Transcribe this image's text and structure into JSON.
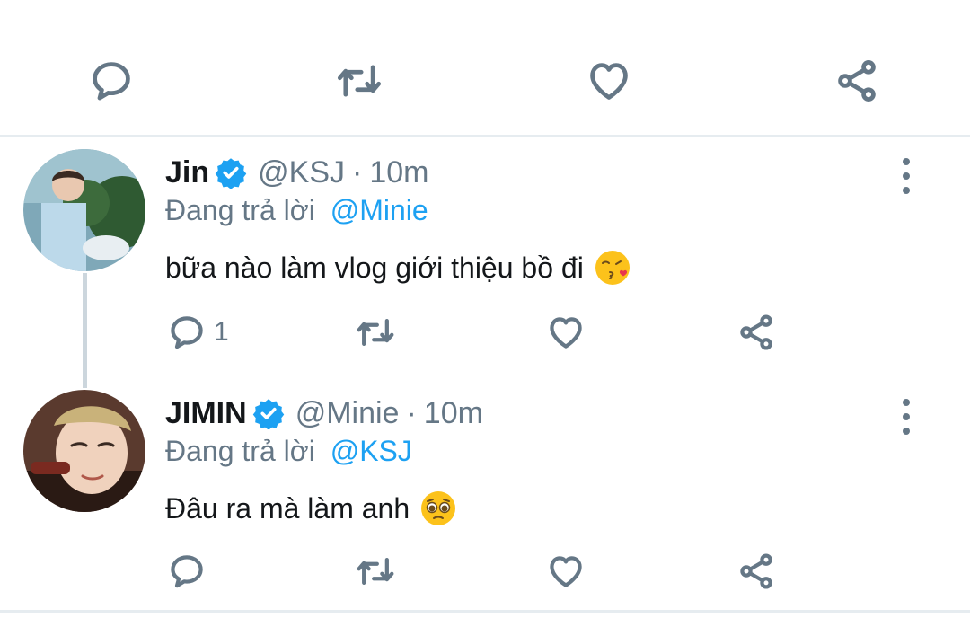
{
  "main_actions": {
    "reply_icon": "reply-icon",
    "retweet_icon": "retweet-icon",
    "like_icon": "heart-icon",
    "share_icon": "share-icon"
  },
  "tweets": [
    {
      "name": "Jin",
      "handle": "@KSJ",
      "separator": "·",
      "time": "10m",
      "replying_prefix": "Đang trả lời",
      "replying_to": "@Minie",
      "text": "bữa nào làm vlog giới thiệu bồ đi",
      "emoji": "face-blowing-kiss-emoji",
      "reply_count": "1"
    },
    {
      "name": "JIMIN",
      "handle": "@Minie",
      "separator": "·",
      "time": "10m",
      "replying_prefix": "Đang trả lời",
      "replying_to": "@KSJ",
      "text": "Đâu ra mà làm anh",
      "emoji": "pleading-face-emoji",
      "reply_count": ""
    }
  ],
  "colors": {
    "accent": "#1da1f2",
    "secondary_text": "#657786",
    "divider": "#e6ecf0",
    "thread_line": "#ccd6dd"
  }
}
